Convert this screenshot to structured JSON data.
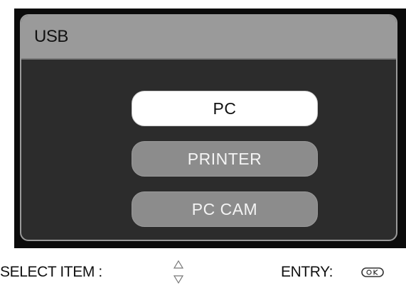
{
  "screen": {
    "title": "USB"
  },
  "menu": {
    "items": [
      {
        "label": "PC",
        "selected": true
      },
      {
        "label": "PRINTER",
        "selected": false
      },
      {
        "label": "PC CAM",
        "selected": false
      }
    ]
  },
  "footer": {
    "select_label": "SELECT ITEM :",
    "select_icon": "up-down-arrows-icon",
    "entry_label": "ENTRY:",
    "entry_icon": "ok-button-icon"
  },
  "colors": {
    "panel_bg": "#2c2c2c",
    "title_bar": "#9a9a9a",
    "selected_item": "#ffffff",
    "unselected_item": "#8c8c8c"
  }
}
